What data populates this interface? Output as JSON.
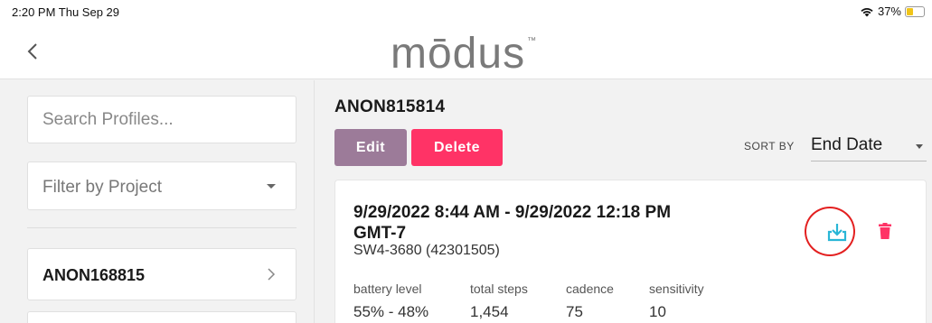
{
  "status_bar": {
    "time": "2:20 PM  Thu Sep 29",
    "battery": "37%",
    "battery_fraction": 0.37,
    "wifi_icon": "wifi-icon"
  },
  "header": {
    "back_icon": "chevron-left-icon",
    "logo_text": "mōdus",
    "logo_tm": "™"
  },
  "sidebar": {
    "search": {
      "placeholder": "Search Profiles...",
      "value": ""
    },
    "filter": {
      "label": "Filter by Project"
    },
    "profiles": [
      {
        "name": "ANON168815"
      },
      {
        "name": ""
      }
    ]
  },
  "main": {
    "profile_title": "ANON815814",
    "edit_label": "Edit",
    "delete_label": "Delete",
    "sort_label": "SORT BY",
    "sort_value": "End Date",
    "session": {
      "date_range": "9/29/2022 8:44 AM - 9/29/2022 12:18 PM GMT-7",
      "device": "SW4-3680 (42301505)",
      "metrics": [
        {
          "label": "battery level",
          "value": "55% - 48%"
        },
        {
          "label": "total steps",
          "value": "1,454"
        },
        {
          "label": "cadence",
          "value": "75"
        },
        {
          "label": "sensitivity",
          "value": "10"
        }
      ]
    }
  },
  "colors": {
    "edit_button": "#9c7b99",
    "delete_button": "#ff3366",
    "download_icon": "#29b6d6",
    "trash_icon": "#ff3366",
    "highlight_circle": "#e32020"
  }
}
